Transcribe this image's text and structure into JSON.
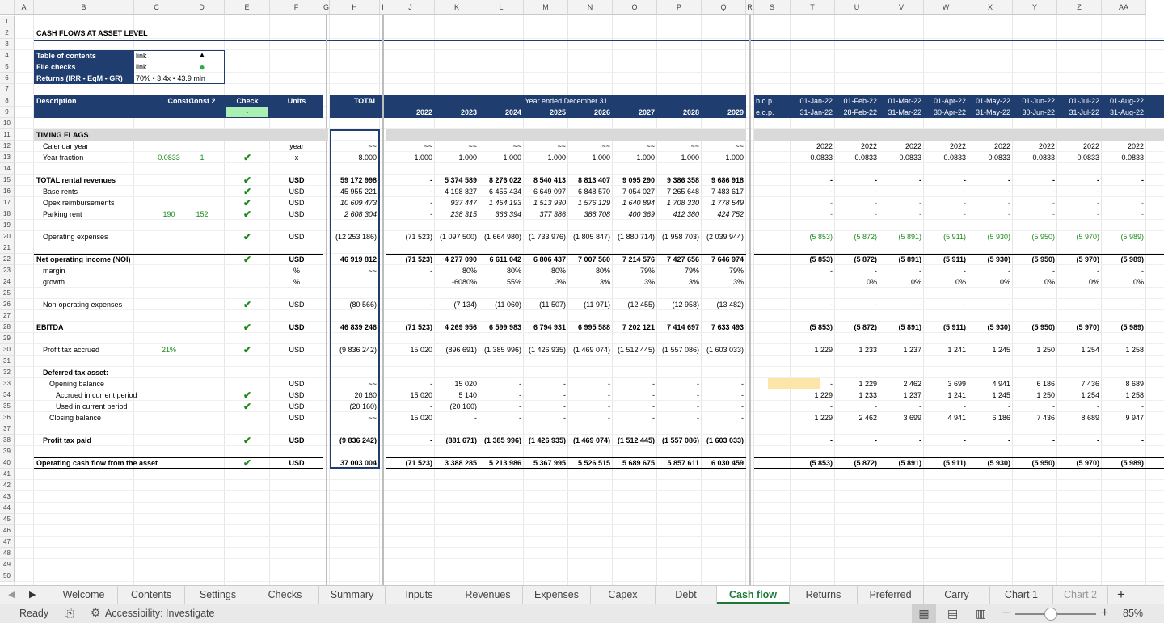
{
  "sheet": {
    "title": "CASH FLOWS AT ASSET LEVEL",
    "columns": [
      "A",
      "B",
      "C",
      "D",
      "E",
      "F",
      "G",
      "H",
      "I",
      "J",
      "K",
      "L",
      "M",
      "N",
      "O",
      "P",
      "Q",
      "R",
      "S",
      "T",
      "U",
      "V",
      "W",
      "X",
      "Y",
      "Z",
      "AA"
    ],
    "rows": [
      "1",
      "2",
      "3",
      "4",
      "5",
      "6",
      "7",
      "8",
      "9",
      "10",
      "11",
      "12",
      "13",
      "14",
      "15",
      "16",
      "17",
      "18",
      "19",
      "20",
      "21",
      "22",
      "23",
      "24",
      "25",
      "26",
      "27",
      "28",
      "29",
      "30",
      "31",
      "32",
      "33",
      "34",
      "35",
      "36",
      "37",
      "38",
      "39",
      "40",
      "41",
      "42",
      "43",
      "44",
      "45",
      "46",
      "47",
      "48",
      "49",
      "50"
    ],
    "toc": {
      "rows": [
        {
          "label": "Table of contents",
          "value": "link",
          "marker": "▲"
        },
        {
          "label": "File checks",
          "value": "link",
          "marker": "●"
        },
        {
          "label": "Returns (IRR • EqM • GR)",
          "value": "70% • 3.4x • 43.9 mln",
          "marker": ""
        }
      ]
    },
    "header": {
      "description": "Description",
      "const1": "Const 1",
      "const2": "Const 2",
      "check": "Check",
      "check_value": "-",
      "units": "Units",
      "total": "TOTAL",
      "year_ended": "Year ended December 31",
      "years": [
        "2022",
        "2023",
        "2024",
        "2025",
        "2026",
        "2027",
        "2028",
        "2029"
      ],
      "bop": "b.o.p.",
      "eop": "e.o.p.",
      "month_starts": [
        "01-Jan-22",
        "01-Feb-22",
        "01-Mar-22",
        "01-Apr-22",
        "01-May-22",
        "01-Jun-22",
        "01-Jul-22",
        "01-Aug-22"
      ],
      "month_ends": [
        "31-Jan-22",
        "28-Feb-22",
        "31-Mar-22",
        "30-Apr-22",
        "31-May-22",
        "30-Jun-22",
        "31-Jul-22",
        "31-Aug-22"
      ]
    },
    "lines": [
      {
        "row": 11,
        "label": "TIMING FLAGS",
        "section": true
      },
      {
        "row": 12,
        "label": "Calendar year",
        "indent": 1,
        "units": "year",
        "total": "~~",
        "years": [
          "~~",
          "~~",
          "~~",
          "~~",
          "~~",
          "~~",
          "~~",
          "~~"
        ],
        "months": [
          "2022",
          "2022",
          "2022",
          "2022",
          "2022",
          "2022",
          "2022",
          "2022"
        ]
      },
      {
        "row": 13,
        "label": "Year fraction",
        "indent": 1,
        "c1": "0.0833",
        "c2": "1",
        "check": true,
        "units": "x",
        "total": "8.000",
        "years": [
          "1.000",
          "1.000",
          "1.000",
          "1.000",
          "1.000",
          "1.000",
          "1.000",
          "1.000"
        ],
        "months": [
          "0.0833",
          "0.0833",
          "0.0833",
          "0.0833",
          "0.0833",
          "0.0833",
          "0.0833",
          "0.0833"
        ]
      },
      {
        "row": 15,
        "label": "TOTAL rental revenues",
        "bold": true,
        "check": true,
        "units": "USD",
        "total": "59 172 998",
        "years": [
          "-",
          "5 374 589",
          "8 276 022",
          "8 540 413",
          "8 813 407",
          "9 095 290",
          "9 386 358",
          "9 686 918"
        ],
        "months": [
          "-",
          "-",
          "-",
          "-",
          "-",
          "-",
          "-",
          "-"
        ],
        "topline": true
      },
      {
        "row": 16,
        "label": "Base rents",
        "indent": 1,
        "check": true,
        "units": "USD",
        "total": "45 955 221",
        "years": [
          "-",
          "4 198 827",
          "6 455 434",
          "6 649 097",
          "6 848 570",
          "7 054 027",
          "7 265 648",
          "7 483 617"
        ],
        "months": [
          "-",
          "-",
          "-",
          "-",
          "-",
          "-",
          "-",
          "-"
        ],
        "mgreen": true
      },
      {
        "row": 17,
        "label": "Opex reimbursements",
        "indent": 1,
        "check": true,
        "units": "USD",
        "total": "10 609 473",
        "italic": true,
        "years": [
          "-",
          "937 447",
          "1 454 193",
          "1 513 930",
          "1 576 129",
          "1 640 894",
          "1 708 330",
          "1 778 549"
        ],
        "months": [
          "-",
          "-",
          "-",
          "-",
          "-",
          "-",
          "-",
          "-"
        ],
        "mgreen": true
      },
      {
        "row": 18,
        "label": "Parking rent",
        "indent": 1,
        "c1": "190",
        "c2": "152",
        "check": true,
        "units": "USD",
        "total": "2 608 304",
        "italic": true,
        "years": [
          "-",
          "238 315",
          "366 394",
          "377 386",
          "388 708",
          "400 369",
          "412 380",
          "424 752"
        ],
        "months": [
          "-",
          "-",
          "-",
          "-",
          "-",
          "-",
          "-",
          "-"
        ],
        "mgreen": true
      },
      {
        "row": 20,
        "label": "Operating expenses",
        "indent": 1,
        "check": true,
        "units": "USD",
        "total": "(12 253 186)",
        "years": [
          "(71 523)",
          "(1 097 500)",
          "(1 664 980)",
          "(1 733 976)",
          "(1 805 847)",
          "(1 880 714)",
          "(1 958 703)",
          "(2 039 944)"
        ],
        "months": [
          "(5 853)",
          "(5 872)",
          "(5 891)",
          "(5 911)",
          "(5 930)",
          "(5 950)",
          "(5 970)",
          "(5 989)"
        ],
        "mgreen": true
      },
      {
        "row": 22,
        "label": "Net operating income (NOI)",
        "bold": true,
        "check": true,
        "units": "USD",
        "total": "46 919 812",
        "years": [
          "(71 523)",
          "4 277 090",
          "6 611 042",
          "6 806 437",
          "7 007 560",
          "7 214 576",
          "7 427 656",
          "7 646 974"
        ],
        "months": [
          "(5 853)",
          "(5 872)",
          "(5 891)",
          "(5 911)",
          "(5 930)",
          "(5 950)",
          "(5 970)",
          "(5 989)"
        ],
        "topline": true
      },
      {
        "row": 23,
        "label": "margin",
        "indent": 1,
        "units": "%",
        "total": "~~",
        "years": [
          "-",
          "80%",
          "80%",
          "80%",
          "80%",
          "79%",
          "79%",
          "79%"
        ],
        "months": [
          "-",
          "-",
          "-",
          "-",
          "-",
          "-",
          "-",
          "-"
        ]
      },
      {
        "row": 24,
        "label": "growth",
        "indent": 1,
        "units": "%",
        "total": "",
        "years": [
          "",
          "-6080%",
          "55%",
          "3%",
          "3%",
          "3%",
          "3%",
          "3%"
        ],
        "months": [
          "",
          "0%",
          "0%",
          "0%",
          "0%",
          "0%",
          "0%",
          "0%"
        ]
      },
      {
        "row": 26,
        "label": "Non-operating expenses",
        "indent": 1,
        "check": true,
        "units": "USD",
        "total": "(80 566)",
        "years": [
          "-",
          "(7 134)",
          "(11 060)",
          "(11 507)",
          "(11 971)",
          "(12 455)",
          "(12 958)",
          "(13 482)"
        ],
        "months": [
          "-",
          "-",
          "-",
          "-",
          "-",
          "-",
          "-",
          "-"
        ],
        "mgreen": true
      },
      {
        "row": 28,
        "label": "EBITDA",
        "bold": true,
        "check": true,
        "units": "USD",
        "total": "46 839 246",
        "years": [
          "(71 523)",
          "4 269 956",
          "6 599 983",
          "6 794 931",
          "6 995 588",
          "7 202 121",
          "7 414 697",
          "7 633 493"
        ],
        "months": [
          "(5 853)",
          "(5 872)",
          "(5 891)",
          "(5 911)",
          "(5 930)",
          "(5 950)",
          "(5 970)",
          "(5 989)"
        ],
        "topline": true
      },
      {
        "row": 30,
        "label": "Profit tax accrued",
        "indent": 1,
        "c1": "21%",
        "check": true,
        "units": "USD",
        "total": "(9 836 242)",
        "years": [
          "15 020",
          "(896 691)",
          "(1 385 996)",
          "(1 426 935)",
          "(1 469 074)",
          "(1 512 445)",
          "(1 557 086)",
          "(1 603 033)"
        ],
        "months": [
          "1 229",
          "1 233",
          "1 237",
          "1 241",
          "1 245",
          "1 250",
          "1 254",
          "1 258"
        ]
      },
      {
        "row": 32,
        "label": "Deferred tax asset:",
        "indent": 1,
        "bold": true
      },
      {
        "row": 33,
        "label": "Opening balance",
        "indent": 2,
        "units": "USD",
        "total": "~~",
        "years": [
          "-",
          "15 020",
          "-",
          "-",
          "-",
          "-",
          "-",
          "-"
        ],
        "months": [
          "-",
          "1 229",
          "2 462",
          "3 699",
          "4 941",
          "6 186",
          "7 436",
          "8 689"
        ],
        "mhl": true
      },
      {
        "row": 34,
        "label": "Accrued in current period",
        "indent": 3,
        "check": true,
        "units": "USD",
        "total": "20 160",
        "years": [
          "15 020",
          "5 140",
          "-",
          "-",
          "-",
          "-",
          "-",
          "-"
        ],
        "months": [
          "1 229",
          "1 233",
          "1 237",
          "1 241",
          "1 245",
          "1 250",
          "1 254",
          "1 258"
        ]
      },
      {
        "row": 35,
        "label": "Used in current period",
        "indent": 3,
        "check": true,
        "units": "USD",
        "total": "(20 160)",
        "years": [
          "-",
          "(20 160)",
          "-",
          "-",
          "-",
          "-",
          "-",
          "-"
        ],
        "months": [
          "-",
          "-",
          "-",
          "-",
          "-",
          "-",
          "-",
          "-"
        ]
      },
      {
        "row": 36,
        "label": "Closing balance",
        "indent": 2,
        "units": "USD",
        "total": "~~",
        "years": [
          "15 020",
          "-",
          "-",
          "-",
          "-",
          "-",
          "-",
          "-"
        ],
        "months": [
          "1 229",
          "2 462",
          "3 699",
          "4 941",
          "6 186",
          "7 436",
          "8 689",
          "9 947"
        ]
      },
      {
        "row": 38,
        "label": "Profit tax paid",
        "indent": 1,
        "bold": true,
        "check": true,
        "units": "USD",
        "total": "(9 836 242)",
        "years": [
          "-",
          "(881 671)",
          "(1 385 996)",
          "(1 426 935)",
          "(1 469 074)",
          "(1 512 445)",
          "(1 557 086)",
          "(1 603 033)"
        ],
        "months": [
          "-",
          "-",
          "-",
          "-",
          "-",
          "-",
          "-",
          "-"
        ]
      },
      {
        "row": 40,
        "label": "Operating cash flow from the asset",
        "bold": true,
        "check": true,
        "units": "USD",
        "total": "37 003 004",
        "years": [
          "(71 523)",
          "3 388 285",
          "5 213 986",
          "5 367 995",
          "5 526 515",
          "5 689 675",
          "5 857 611",
          "6 030 459"
        ],
        "months": [
          "(5 853)",
          "(5 872)",
          "(5 891)",
          "(5 911)",
          "(5 930)",
          "(5 950)",
          "(5 970)",
          "(5 989)"
        ],
        "topline": true,
        "dblline": true
      }
    ]
  },
  "tabs": [
    "Welcome",
    "Contents",
    "Settings",
    "Checks",
    "Summary",
    "Inputs",
    "Revenues",
    "Expenses",
    "Capex",
    "Debt",
    "Cash flow",
    "Returns",
    "Preferred",
    "Carry",
    "Chart 1",
    "Chart 2"
  ],
  "active_tab": "Cash flow",
  "add_sheet": "+",
  "status": {
    "ready": "Ready",
    "accessibility": "Accessibility: Investigate",
    "zoom": "85%",
    "zoom_level": 0.85
  },
  "colors": {
    "navy": "#1f3d6e",
    "green": "#1a8a1a",
    "check_fill": "#a9f0b2",
    "highlight": "#fde4a8",
    "active_tab": "#1b7a38"
  }
}
